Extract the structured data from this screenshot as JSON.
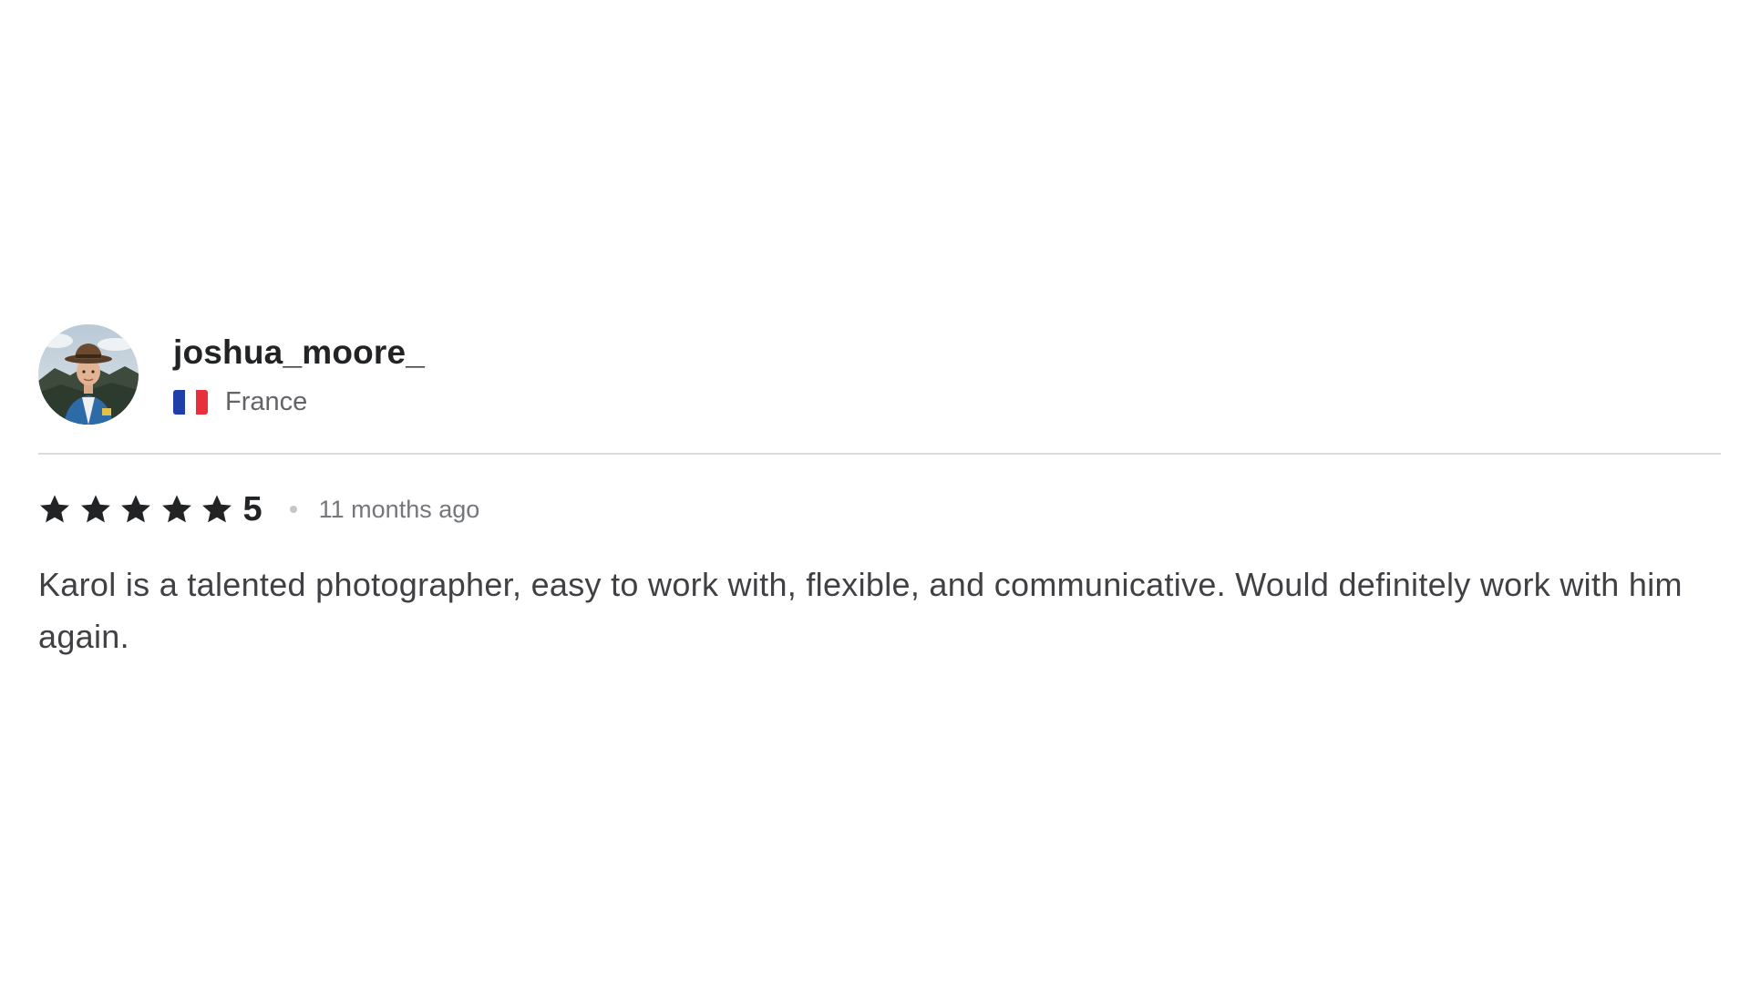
{
  "review": {
    "username": "joshua_moore_",
    "country": "France",
    "rating": {
      "value": 5,
      "max": 5,
      "display": "5"
    },
    "time_ago": "11 months ago",
    "text": "Karol is a talented photographer, easy to work with, flexible, and communicative. Would definitely work with him again."
  },
  "icons": {
    "avatar": "user-avatar-photo",
    "flag": "france-flag-icon",
    "star": "star-icon"
  },
  "colors": {
    "flag_blue": "#1e3fa8",
    "flag_red": "#e8303c",
    "star": "#222325",
    "text": "#404145"
  }
}
